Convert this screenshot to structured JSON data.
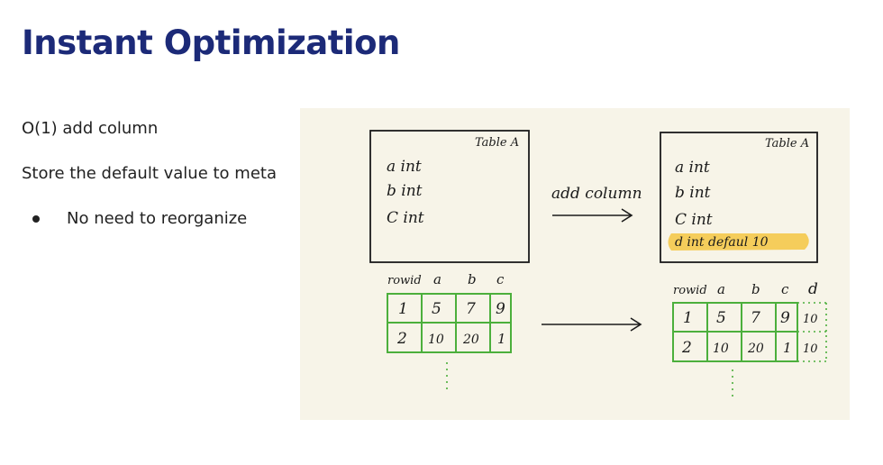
{
  "title": "Instant Optimization",
  "body": {
    "line1": "O(1) add column",
    "line2": "Store the default value to meta",
    "bullet": "No need to reorganize"
  },
  "sketch": {
    "left_table": {
      "name": "Table A",
      "columns": [
        "a int",
        "b int",
        "C int"
      ]
    },
    "arrow_label": "add column",
    "right_table": {
      "name": "Table A",
      "columns": [
        "a int",
        "b int",
        "C int"
      ],
      "new_column": "d int defaul 10"
    },
    "left_grid": {
      "headers": [
        "rowid",
        "a",
        "b",
        "c"
      ],
      "rows": [
        [
          "1",
          "5",
          "7",
          "9"
        ],
        [
          "2",
          "10",
          "20",
          "1"
        ]
      ]
    },
    "right_grid": {
      "headers": [
        "rowid",
        "a",
        "b",
        "c",
        "d"
      ],
      "rows": [
        [
          "1",
          "5",
          "7",
          "9",
          "10"
        ],
        [
          "2",
          "10",
          "20",
          "1",
          "10"
        ]
      ]
    },
    "colors": {
      "green": "#4caf3c",
      "highlight": "#f5c542",
      "ink": "#1b1b1b",
      "background": "#f7f4e8"
    }
  }
}
